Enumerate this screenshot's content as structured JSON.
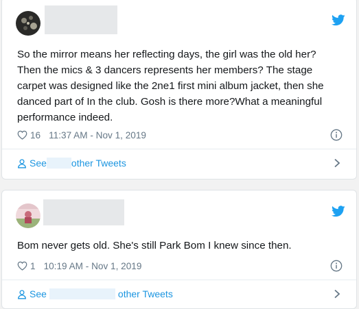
{
  "tweets": [
    {
      "text": "So the mirror means her reflecting days, the girl was the old her? Then the mics & 3 dancers represents her members? The stage carpet was designed like the 2ne1 first mini album jacket, then she danced part of In the club. Gosh is there more?What a meaningful performance indeed.",
      "likes": "16",
      "timestamp": "11:37 AM - Nov 1, 2019",
      "see_prefix": "See",
      "see_suffix": "other Tweets"
    },
    {
      "text": "Bom never gets old. She's still Park Bom I knew since then.",
      "likes": "1",
      "timestamp": "10:19 AM - Nov 1, 2019",
      "see_prefix": "See",
      "see_suffix": "other Tweets"
    }
  ],
  "icons": {
    "bird": "twitter-bird-icon",
    "heart": "heart-icon",
    "info": "info-icon",
    "person": "person-icon",
    "chevron": "chevron-right-icon"
  },
  "colors": {
    "twitter_blue": "#1da1f2",
    "link_blue": "#1b95e0",
    "text": "#14171a",
    "meta": "#657786"
  }
}
